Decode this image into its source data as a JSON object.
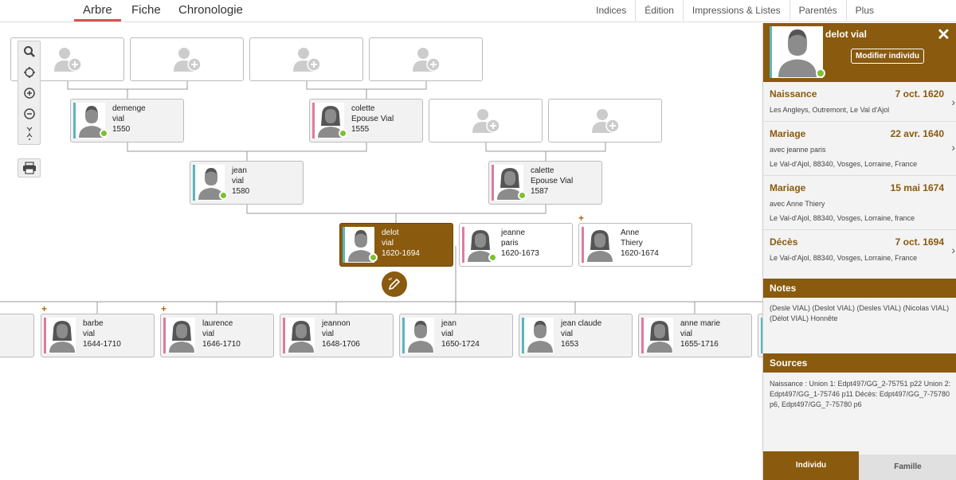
{
  "tabs": [
    "Arbre",
    "Fiche",
    "Chronologie"
  ],
  "menu": [
    "Indices",
    "Édition",
    "Impressions & Listes",
    "Parentés",
    "Plus"
  ],
  "people": {
    "demenge": {
      "l1": "demenge",
      "l2": "vial",
      "l3": "1550"
    },
    "colette": {
      "l1": "colette",
      "l2": "Epouse Vial",
      "l3": "1555"
    },
    "jean1": {
      "l1": "jean",
      "l2": "vial",
      "l3": "1580"
    },
    "calette": {
      "l1": "calette",
      "l2": "Epouse Vial",
      "l3": "1587"
    },
    "delot": {
      "l1": "delot",
      "l2": "vial",
      "l3": "1620-1694"
    },
    "jeanne": {
      "l1": "jeanne",
      "l2": "paris",
      "l3": "1620-1673"
    },
    "anne": {
      "l1": "Anne",
      "l2": "Thiery",
      "l3": "1620-1674"
    },
    "barbe": {
      "l1": "barbe",
      "l2": "vial",
      "l3": "1644-1710"
    },
    "laurence": {
      "l1": "laurence",
      "l2": "vial",
      "l3": "1646-1710"
    },
    "jeannon": {
      "l1": "jeannon",
      "l2": "vial",
      "l3": "1648-1706"
    },
    "jean2": {
      "l1": "jean",
      "l2": "vial",
      "l3": "1650-1724"
    },
    "jeanclaude": {
      "l1": "jean claude",
      "l2": "vial",
      "l3": "1653"
    },
    "annemarie": {
      "l1": "anne marie",
      "l2": "vial",
      "l3": "1655-1716"
    }
  },
  "plus_marker": "+",
  "panel": {
    "name": "delot vial",
    "modify_label": "Modifier individu",
    "close": "✕",
    "events": [
      {
        "type": "Naissance",
        "date": "7 oct. 1620",
        "with": "",
        "place": "Les Angleys, Outremont, Le Val d'Ajol"
      },
      {
        "type": "Mariage",
        "date": "22 avr. 1640",
        "with": "avec jeanne paris",
        "place": "Le Val-d'Ajol, 88340, Vosges, Lorraine, France"
      },
      {
        "type": "Mariage",
        "date": "15 mai 1674",
        "with": "avec Anne Thiery",
        "place": "Le Val-d'Ajol, 88340, Vosges, Lorraine, france"
      },
      {
        "type": "Décès",
        "date": "7 oct. 1694",
        "with": "",
        "place": "Le Val-d'Ajol, 88340, Vosges, Lorraine, France"
      }
    ],
    "notes_title": "Notes",
    "notes": "(Desle VIAL) (Deslot VIAL) (Desles VIAL) (Nicolas VIAL) (Délot VIAL) Honnête",
    "sources_title": "Sources",
    "sources": "Naissance : Union 1: Edpt497/GG_2-75751 p22 Union 2: Edpt497/GG_1-75746 p11 Décès: Edpt497/GG_7-75780 p6, Edpt497/GG_7-75780 p6",
    "tab_individu": "Individu",
    "tab_famille": "Famille"
  },
  "colors": {
    "accent": "#8a5a0e",
    "male": "#5bb5bd",
    "female": "#e07aa0",
    "status": "#7cc12e",
    "active_tab": "#d9534f"
  }
}
